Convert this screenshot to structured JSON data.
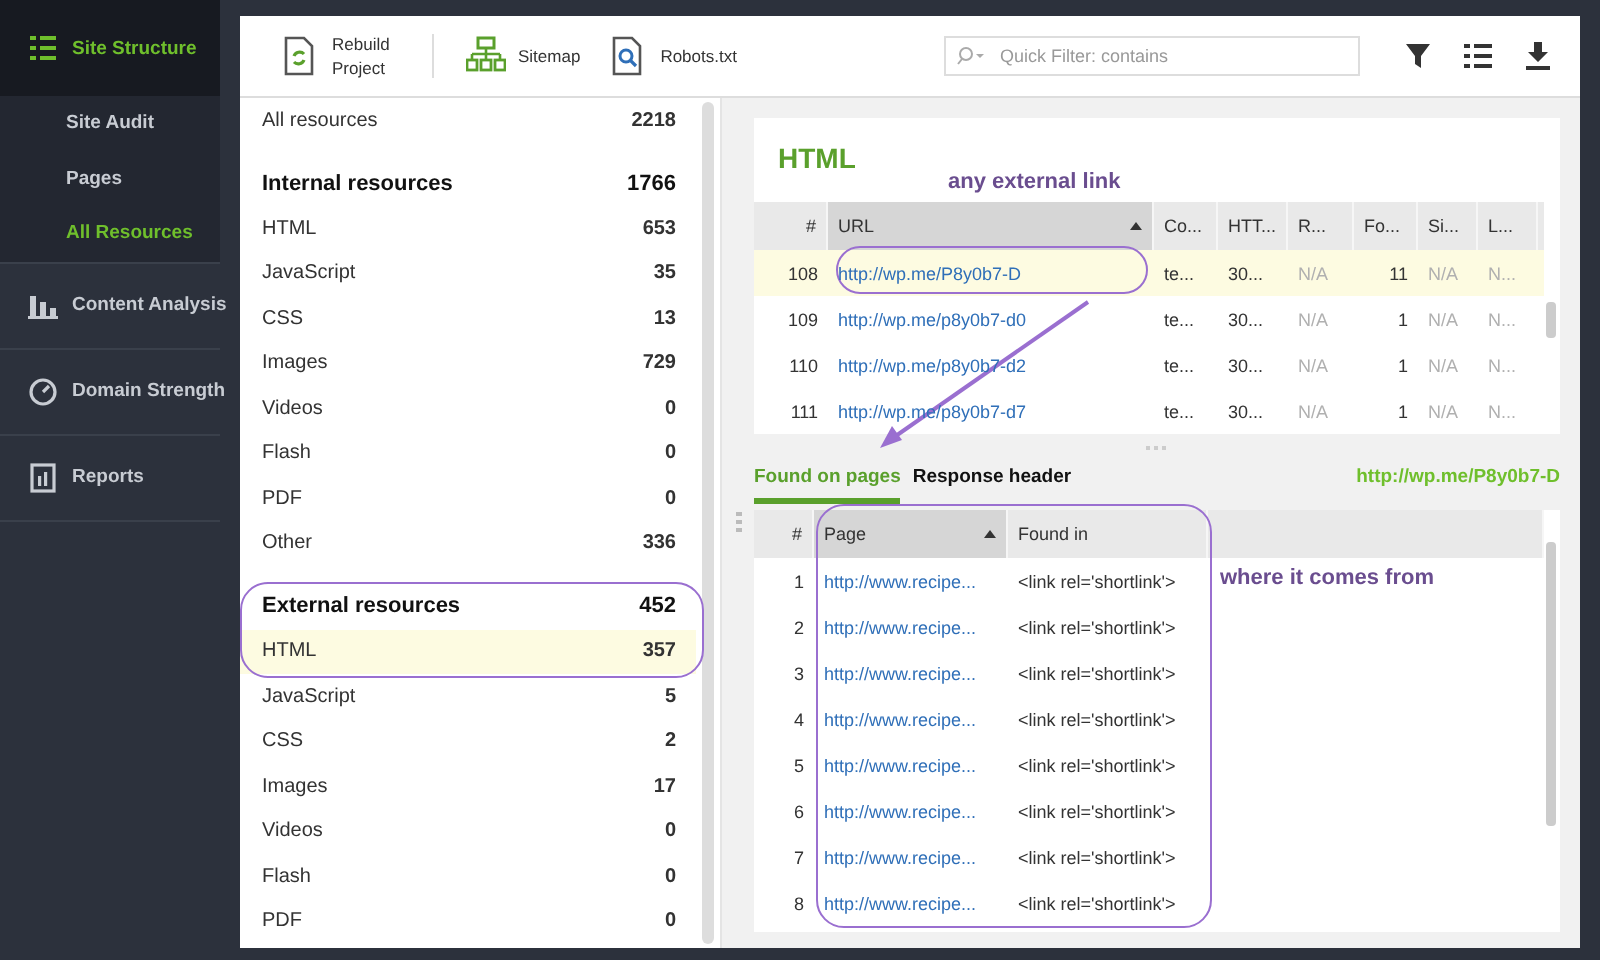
{
  "sidebar": {
    "items": [
      {
        "label": "Site Structure",
        "selected": true,
        "children": [
          {
            "label": "Site Audit",
            "selected": false
          },
          {
            "label": "Pages",
            "selected": false
          },
          {
            "label": "All Resources",
            "selected": true
          }
        ]
      },
      {
        "label": "Content Analysis",
        "selected": false
      },
      {
        "label": "Domain Strength",
        "selected": false
      },
      {
        "label": "Reports",
        "selected": false
      }
    ]
  },
  "toolbar": {
    "buttons": [
      "Rebuild Project",
      "Sitemap",
      "Robots.txt"
    ],
    "search": {
      "placeholder": "Quick Filter: contains"
    }
  },
  "resources": [
    {
      "kind": "total",
      "label": "All resources",
      "count": "2218",
      "selected": false
    },
    {
      "kind": "group",
      "label": "Internal resources",
      "count": "1766",
      "selected": false
    },
    {
      "kind": "item",
      "label": "HTML",
      "count": "653",
      "selected": false
    },
    {
      "kind": "item",
      "label": "JavaScript",
      "count": "35",
      "selected": false
    },
    {
      "kind": "item",
      "label": "CSS",
      "count": "13",
      "selected": false
    },
    {
      "kind": "item",
      "label": "Images",
      "count": "729",
      "selected": false
    },
    {
      "kind": "item",
      "label": "Videos",
      "count": "0",
      "selected": false
    },
    {
      "kind": "item",
      "label": "Flash",
      "count": "0",
      "selected": false
    },
    {
      "kind": "item",
      "label": "PDF",
      "count": "0",
      "selected": false
    },
    {
      "kind": "item",
      "label": "Other",
      "count": "336",
      "selected": false
    },
    {
      "kind": "group",
      "label": "External resources",
      "count": "452",
      "selected": false
    },
    {
      "kind": "item",
      "label": "HTML",
      "count": "357",
      "selected": true
    },
    {
      "kind": "item",
      "label": "JavaScript",
      "count": "5",
      "selected": false
    },
    {
      "kind": "item",
      "label": "CSS",
      "count": "2",
      "selected": false
    },
    {
      "kind": "item",
      "label": "Images",
      "count": "17",
      "selected": false
    },
    {
      "kind": "item",
      "label": "Videos",
      "count": "0",
      "selected": false
    },
    {
      "kind": "item",
      "label": "Flash",
      "count": "0",
      "selected": false
    },
    {
      "kind": "item",
      "label": "PDF",
      "count": "0",
      "selected": false
    }
  ],
  "detail": {
    "title": "HTML",
    "table": {
      "columns": [
        {
          "label": "#",
          "sorted": false,
          "muted": false
        },
        {
          "label": "URL",
          "sorted": true,
          "muted": false
        },
        {
          "label": "Co...",
          "sorted": false,
          "muted": false
        },
        {
          "label": "HTT...",
          "sorted": false,
          "muted": false
        },
        {
          "label": "R...",
          "sorted": false,
          "muted": true
        },
        {
          "label": "Fo...",
          "sorted": false,
          "muted": false
        },
        {
          "label": "Si...",
          "sorted": false,
          "muted": true
        },
        {
          "label": "L...",
          "sorted": false,
          "muted": true
        }
      ],
      "rows": [
        {
          "selected": true,
          "cells": [
            "108",
            "http://wp.me/P8y0b7-D",
            "te...",
            "30...",
            "N/A",
            "11",
            "N/A",
            "N..."
          ]
        },
        {
          "selected": false,
          "cells": [
            "109",
            "http://wp.me/p8y0b7-d0",
            "te...",
            "30...",
            "N/A",
            "1",
            "N/A",
            "N..."
          ]
        },
        {
          "selected": false,
          "cells": [
            "110",
            "http://wp.me/p8y0b7-d2",
            "te...",
            "30...",
            "N/A",
            "1",
            "N/A",
            "N..."
          ]
        },
        {
          "selected": false,
          "cells": [
            "111",
            "http://wp.me/p8y0b7-d7",
            "te...",
            "30...",
            "N/A",
            "1",
            "N/A",
            "N..."
          ]
        }
      ]
    },
    "tabs": [
      {
        "label": "Found on pages",
        "selected": true
      },
      {
        "label": "Response header",
        "selected": false
      }
    ],
    "current_url": "http://wp.me/P8y0b7-D",
    "found_table": {
      "columns": [
        {
          "label": "#",
          "sorted": false
        },
        {
          "label": "Page",
          "sorted": true
        },
        {
          "label": "Found in",
          "sorted": false
        }
      ],
      "rows": [
        {
          "cells": [
            "1",
            "http://www.recipe...",
            "<link rel='shortlink'>"
          ]
        },
        {
          "cells": [
            "2",
            "http://www.recipe...",
            "<link rel='shortlink'>"
          ]
        },
        {
          "cells": [
            "3",
            "http://www.recipe...",
            "<link rel='shortlink'>"
          ]
        },
        {
          "cells": [
            "4",
            "http://www.recipe...",
            "<link rel='shortlink'>"
          ]
        },
        {
          "cells": [
            "5",
            "http://www.recipe...",
            "<link rel='shortlink'>"
          ]
        },
        {
          "cells": [
            "6",
            "http://www.recipe...",
            "<link rel='shortlink'>"
          ]
        },
        {
          "cells": [
            "7",
            "http://www.recipe...",
            "<link rel='shortlink'>"
          ]
        },
        {
          "cells": [
            "8",
            "http://www.recipe...",
            "<link rel='shortlink'>"
          ]
        }
      ]
    }
  },
  "annotations": [
    "any external link",
    "where it comes from"
  ]
}
